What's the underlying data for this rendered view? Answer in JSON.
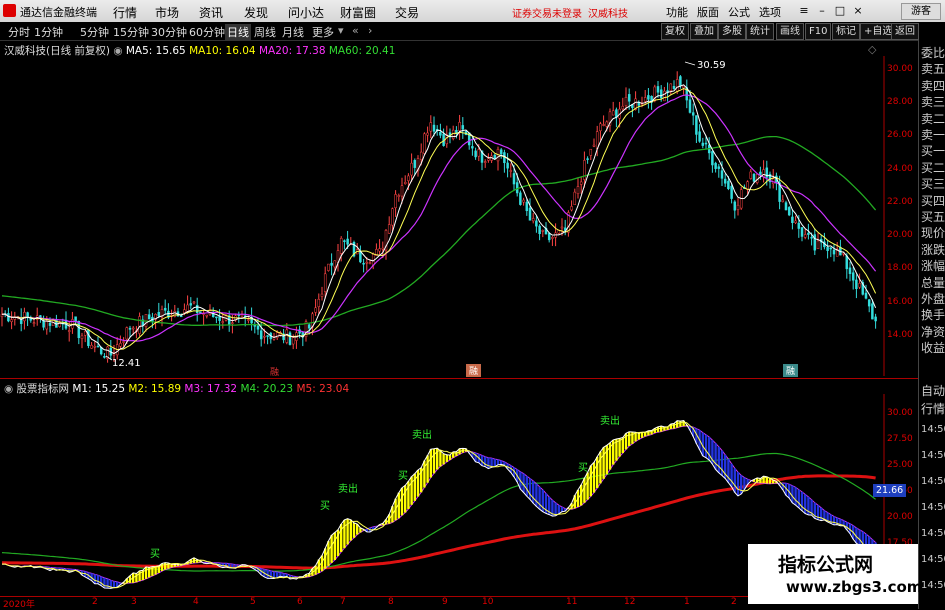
{
  "menubar": {
    "app_name": "通达信金融终端",
    "menus": [
      "行情",
      "市场",
      "资讯",
      "发现",
      "问小达",
      "财富圈",
      "交易"
    ],
    "warning": "证券交易未登录",
    "stock": "汉威科技",
    "right_menus": [
      "功能",
      "版面",
      "公式",
      "选项"
    ],
    "guest": "游客"
  },
  "tabs": {
    "periods": [
      "分时",
      "1分钟",
      "5分钟",
      "15分钟",
      "30分钟",
      "60分钟",
      "日线",
      "周线",
      "月线",
      "更多"
    ],
    "active": "日线",
    "buttons": [
      "复权",
      "叠加",
      "多股",
      "统计",
      "画线",
      "F10",
      "标记",
      "+自选",
      "返回"
    ]
  },
  "main_chart": {
    "title": "汉威科技(日线 前复权)",
    "ma": [
      {
        "label": "MA5: 15.65",
        "color": "#ffffff"
      },
      {
        "label": "MA10: 16.04",
        "color": "#ffff00"
      },
      {
        "label": "MA20: 17.38",
        "color": "#ff33ff"
      },
      {
        "label": "MA60: 20.41",
        "color": "#33dd33"
      }
    ],
    "y_ticks": [
      "30.00",
      "28.00",
      "26.00",
      "24.00",
      "22.00",
      "20.00",
      "18.00",
      "16.00",
      "14.00"
    ],
    "high_label": "30.59",
    "low_label": "12.41",
    "markers": [
      "融",
      "融",
      "融"
    ],
    "color_close": "#ffffff",
    "color_ma5": "#ffffff",
    "color_ma10": "#ffff00",
    "color_ma20": "#cc33ff",
    "color_ma60": "#22aa22"
  },
  "sub_chart": {
    "title": "股票指标网",
    "lines": [
      {
        "label": "M1: 15.25",
        "color": "#ffffff"
      },
      {
        "label": "M2: 15.89",
        "color": "#ffff00"
      },
      {
        "label": "M3: 17.32",
        "color": "#ff33ff"
      },
      {
        "label": "M4: 20.23",
        "color": "#33dd33"
      },
      {
        "label": "M5: 23.04",
        "color": "#ff3333"
      }
    ],
    "y_ticks": [
      "30.00",
      "27.50",
      "25.00",
      "22.50",
      "20.00",
      "17.50"
    ],
    "current_value": "21.66",
    "signal_buy": "买",
    "signal_sell": "卖出"
  },
  "right_column": {
    "items": [
      "委比",
      "卖五",
      "卖四",
      "卖三",
      "卖二",
      "卖一",
      "买一",
      "买二",
      "买三",
      "买四",
      "买五",
      "现价",
      "涨跌",
      "涨幅",
      "总量",
      "外盘",
      "换手",
      "净资",
      "收益"
    ],
    "lower_items": [
      "自动",
      "行情"
    ],
    "prices": [
      "14:50",
      "14:50",
      "14:50",
      "14:50",
      "14:50",
      "14:50",
      "14:50"
    ]
  },
  "dates": [
    "2020年",
    "2",
    "3",
    "4",
    "5",
    "6",
    "7",
    "8",
    "9",
    "10",
    "11",
    "12",
    "1",
    "2",
    "3"
  ],
  "watermark": {
    "title": "指标公式网",
    "url": "www.zbgs3.com"
  }
}
